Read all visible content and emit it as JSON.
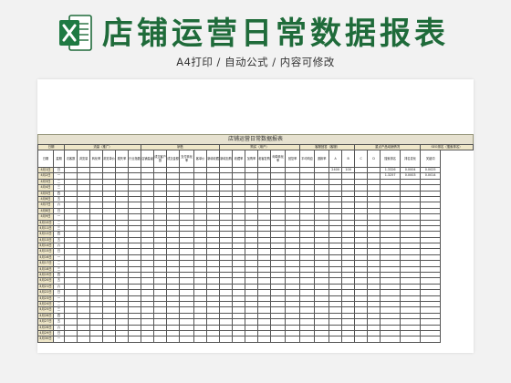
{
  "header": {
    "title": "店铺运营日常数据报表",
    "subtitle": "A4打印 / 自动公式 / 内容可修改"
  },
  "sheet": {
    "title": "店铺运营日常数据报表",
    "group_headers": [
      "日期",
      "流量（推广）",
      "销售",
      "购买（用户）",
      "客服回答（客服）",
      "重点产品动销情况",
      "SEO排名（搜索排名）"
    ],
    "col_headers": [
      "日期",
      "星期",
      "访客数",
      "浏览量",
      "转化率",
      "浏览单价",
      "跳失率",
      "行业指数",
      "店铺星级",
      "成交客户数",
      "成交金额",
      "支付转化率",
      "客单价",
      "新增收藏",
      "新增加购",
      "收藏率",
      "加购率",
      "老客复购",
      "询单转化率",
      "回复率",
      "平均响应",
      "退款率",
      "A",
      "B",
      "C",
      "D",
      "搜索排名",
      "排名变化",
      "关键词"
    ],
    "product_values": [
      "2400",
      "100"
    ],
    "seo_values": [
      [
        "1.3326",
        "0.0004",
        "0.0025"
      ],
      [
        "1.3257",
        "0.0003",
        "0.0014"
      ]
    ],
    "rows": [
      {
        "date": "4月1日",
        "week": "日"
      },
      {
        "date": "4月2日",
        "week": "一"
      },
      {
        "date": "4月3日",
        "week": "二"
      },
      {
        "date": "4月4日",
        "week": "三"
      },
      {
        "date": "4月5日",
        "week": "四"
      },
      {
        "date": "4月6日",
        "week": "五"
      },
      {
        "date": "4月7日",
        "week": "六"
      },
      {
        "date": "4月8日",
        "week": "日"
      },
      {
        "date": "4月9日",
        "week": "一"
      },
      {
        "date": "4月10日",
        "week": "二"
      },
      {
        "date": "4月11日",
        "week": "三"
      },
      {
        "date": "4月12日",
        "week": "四"
      },
      {
        "date": "4月13日",
        "week": "五"
      },
      {
        "date": "4月14日",
        "week": "六"
      },
      {
        "date": "4月15日",
        "week": "日"
      },
      {
        "date": "4月16日",
        "week": "一"
      },
      {
        "date": "4月17日",
        "week": "二"
      },
      {
        "date": "4月18日",
        "week": "三"
      },
      {
        "date": "4月19日",
        "week": "四"
      },
      {
        "date": "4月20日",
        "week": "五"
      },
      {
        "date": "4月21日",
        "week": "六"
      },
      {
        "date": "4月22日",
        "week": "日"
      },
      {
        "date": "4月23日",
        "week": "一"
      },
      {
        "date": "4月24日",
        "week": "二"
      },
      {
        "date": "4月25日",
        "week": "三"
      },
      {
        "date": "4月26日",
        "week": "四"
      },
      {
        "date": "4月27日",
        "week": "五"
      },
      {
        "date": "4月28日",
        "week": "六"
      },
      {
        "date": "4月29日",
        "week": "日"
      },
      {
        "date": "4月30日",
        "week": "一"
      }
    ]
  },
  "colors": {
    "brand_green": "#1f6b3a",
    "header_fill": "#eee6c8",
    "page_bg": "#f2f2f2"
  }
}
